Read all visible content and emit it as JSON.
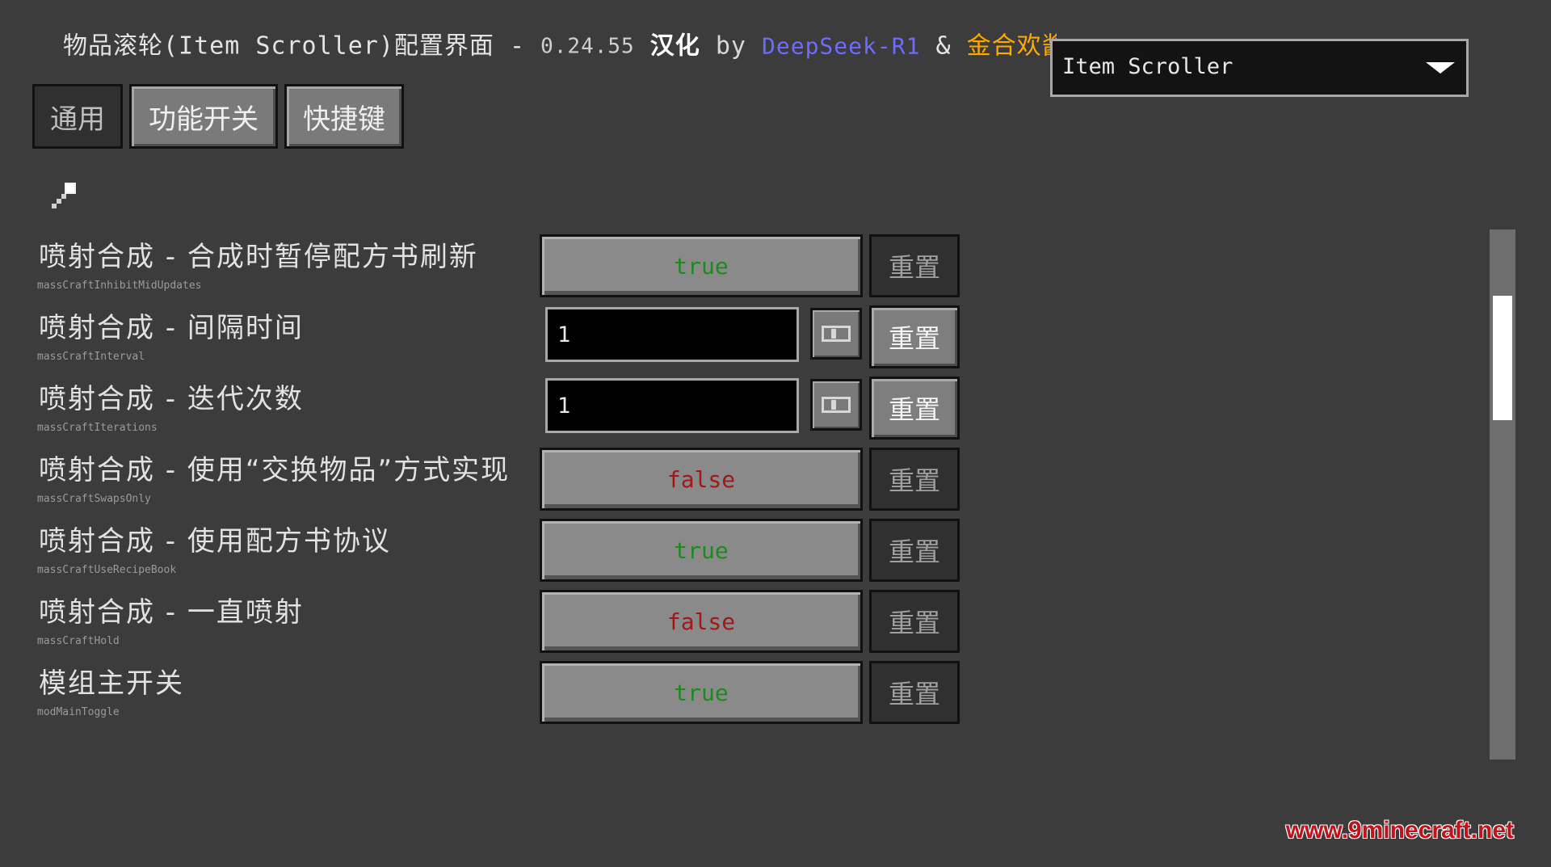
{
  "title": {
    "main": "物品滚轮(Item Scroller)配置界面 - ",
    "version": "0.24.55",
    "han": " 汉化 ",
    "by": "by ",
    "deepseek": "DeepSeek-R1",
    "amp": " & ",
    "jin": "金合欢酱(acac"
  },
  "mod_selector": {
    "value": "Item Scroller",
    "icon": "chevron-down-icon"
  },
  "tabs": [
    {
      "label": "通用",
      "active": true
    },
    {
      "label": "功能开关",
      "active": false
    },
    {
      "label": "快捷键",
      "active": false
    }
  ],
  "search_icon": "search-icon",
  "options": [
    {
      "label": "喷射合成 - 合成时暂停配方书刷新",
      "key": "massCraftInhibitMidUpdates",
      "type": "boolean",
      "value": "true",
      "reset": "重置",
      "reset_enabled": false
    },
    {
      "label": "喷射合成 - 间隔时间",
      "key": "massCraftInterval",
      "type": "integer",
      "value": "1",
      "reset": "重置",
      "reset_enabled": true
    },
    {
      "label": "喷射合成 - 迭代次数",
      "key": "massCraftIterations",
      "type": "integer",
      "value": "1",
      "reset": "重置",
      "reset_enabled": true
    },
    {
      "label": "喷射合成 - 使用“交换物品”方式实现",
      "key": "massCraftSwapsOnly",
      "type": "boolean",
      "value": "false",
      "reset": "重置",
      "reset_enabled": false
    },
    {
      "label": "喷射合成 - 使用配方书协议",
      "key": "massCraftUseRecipeBook",
      "type": "boolean",
      "value": "true",
      "reset": "重置",
      "reset_enabled": false
    },
    {
      "label": "喷射合成 - 一直喷射",
      "key": "massCraftHold",
      "type": "boolean",
      "value": "false",
      "reset": "重置",
      "reset_enabled": false
    },
    {
      "label": "模组主开关",
      "key": "modMainToggle",
      "type": "boolean",
      "value": "true",
      "reset": "重置",
      "reset_enabled": false
    }
  ],
  "watermark": "www.9minecraft.net",
  "colors": {
    "true": "#1e8a1e",
    "false": "#a01818",
    "deepseek": "#6c6cff",
    "jin": "#ffaa00"
  }
}
